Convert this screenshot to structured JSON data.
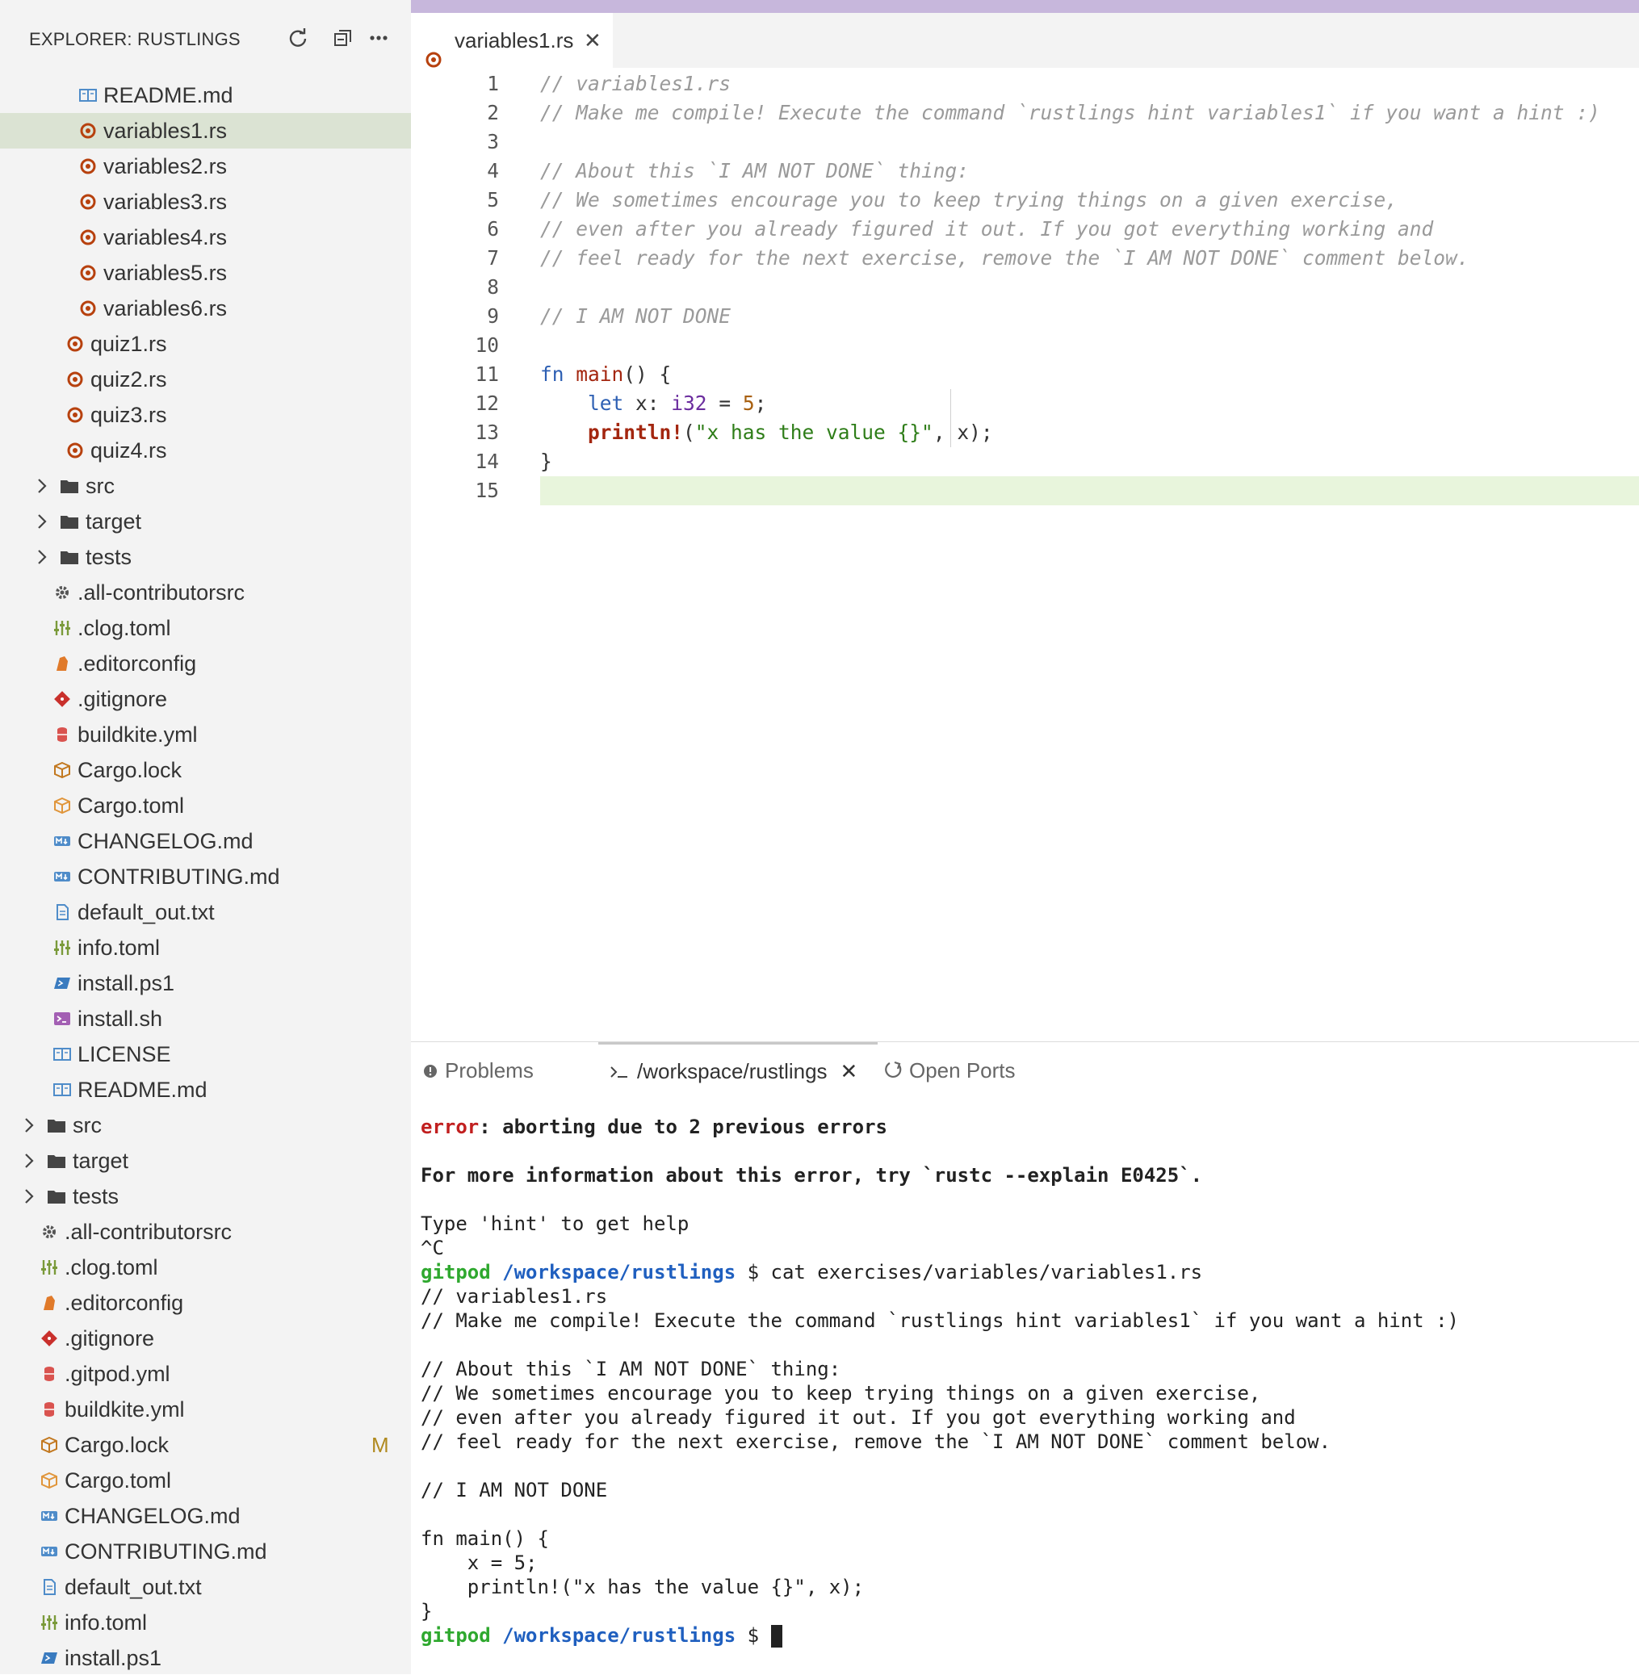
{
  "sidebar": {
    "title": "EXPLORER: RUSTLINGS",
    "tree": [
      {
        "label": "README.md",
        "icon": "readme-icon",
        "level": 3
      },
      {
        "label": "variables1.rs",
        "icon": "rust-file-icon",
        "level": 3,
        "selected": true
      },
      {
        "label": "variables2.rs",
        "icon": "rust-file-icon",
        "level": 3
      },
      {
        "label": "variables3.rs",
        "icon": "rust-file-icon",
        "level": 3
      },
      {
        "label": "variables4.rs",
        "icon": "rust-file-icon",
        "level": 3
      },
      {
        "label": "variables5.rs",
        "icon": "rust-file-icon",
        "level": 3
      },
      {
        "label": "variables6.rs",
        "icon": "rust-file-icon",
        "level": 3
      },
      {
        "label": "quiz1.rs",
        "icon": "rust-file-icon",
        "level": 2
      },
      {
        "label": "quiz2.rs",
        "icon": "rust-file-icon",
        "level": 2
      },
      {
        "label": "quiz3.rs",
        "icon": "rust-file-icon",
        "level": 2
      },
      {
        "label": "quiz4.rs",
        "icon": "rust-file-icon",
        "level": 2
      },
      {
        "label": "src",
        "icon": "folder-icon",
        "level": 1,
        "folder": true
      },
      {
        "label": "target",
        "icon": "folder-icon",
        "level": 1,
        "folder": true
      },
      {
        "label": "tests",
        "icon": "folder-icon",
        "level": 1,
        "folder": true
      },
      {
        "label": ".all-contributorsrc",
        "icon": "gear-icon",
        "level": 1
      },
      {
        "label": ".clog.toml",
        "icon": "toml-icon",
        "level": 1
      },
      {
        "label": ".editorconfig",
        "icon": "editorconfig-icon",
        "level": 1
      },
      {
        "label": ".gitignore",
        "icon": "git-icon",
        "level": 1
      },
      {
        "label": "buildkite.yml",
        "icon": "yaml-icon",
        "level": 1
      },
      {
        "label": "Cargo.lock",
        "icon": "cargo-lock-icon",
        "level": 1
      },
      {
        "label": "Cargo.toml",
        "icon": "cargo-icon",
        "level": 1
      },
      {
        "label": "CHANGELOG.md",
        "icon": "markdown-icon",
        "level": 1
      },
      {
        "label": "CONTRIBUTING.md",
        "icon": "markdown-icon",
        "level": 1
      },
      {
        "label": "default_out.txt",
        "icon": "text-file-icon",
        "level": 1
      },
      {
        "label": "info.toml",
        "icon": "toml-icon",
        "level": 1
      },
      {
        "label": "install.ps1",
        "icon": "powershell-icon",
        "level": 1
      },
      {
        "label": "install.sh",
        "icon": "shell-icon",
        "level": 1
      },
      {
        "label": "LICENSE",
        "icon": "license-icon",
        "level": 1
      },
      {
        "label": "README.md",
        "icon": "readme-icon",
        "level": 1
      },
      {
        "label": "src",
        "icon": "folder-icon",
        "level": 0,
        "folder": true
      },
      {
        "label": "target",
        "icon": "folder-icon",
        "level": 0,
        "folder": true
      },
      {
        "label": "tests",
        "icon": "folder-icon",
        "level": 0,
        "folder": true
      },
      {
        "label": ".all-contributorsrc",
        "icon": "gear-icon",
        "level": 0
      },
      {
        "label": ".clog.toml",
        "icon": "toml-icon",
        "level": 0
      },
      {
        "label": ".editorconfig",
        "icon": "editorconfig-icon",
        "level": 0
      },
      {
        "label": ".gitignore",
        "icon": "git-icon",
        "level": 0
      },
      {
        "label": ".gitpod.yml",
        "icon": "yaml-icon",
        "level": 0
      },
      {
        "label": "buildkite.yml",
        "icon": "yaml-icon",
        "level": 0
      },
      {
        "label": "Cargo.lock",
        "icon": "cargo-lock-icon",
        "level": 0,
        "badge": "M"
      },
      {
        "label": "Cargo.toml",
        "icon": "cargo-icon",
        "level": 0
      },
      {
        "label": "CHANGELOG.md",
        "icon": "markdown-icon",
        "level": 0
      },
      {
        "label": "CONTRIBUTING.md",
        "icon": "markdown-icon",
        "level": 0
      },
      {
        "label": "default_out.txt",
        "icon": "text-file-icon",
        "level": 0
      },
      {
        "label": "info.toml",
        "icon": "toml-icon",
        "level": 0
      },
      {
        "label": "install.ps1",
        "icon": "powershell-icon",
        "level": 0
      }
    ]
  },
  "editor": {
    "tab_label": "variables1.rs",
    "tab_close": "✕",
    "lines": [
      [
        {
          "t": "// variables1.rs",
          "c": "cmt"
        }
      ],
      [
        {
          "t": "// Make me compile! Execute the command `rustlings hint variables1` if you want a hint :)",
          "c": "cmt"
        }
      ],
      [],
      [
        {
          "t": "// About this `I AM NOT DONE` thing:",
          "c": "cmt"
        }
      ],
      [
        {
          "t": "// We sometimes encourage you to keep trying things on a given exercise,",
          "c": "cmt"
        }
      ],
      [
        {
          "t": "// even after you already figured it out. If you got everything working and",
          "c": "cmt"
        }
      ],
      [
        {
          "t": "// feel ready for the next exercise, remove the `I AM NOT DONE` comment below.",
          "c": "cmt"
        }
      ],
      [],
      [
        {
          "t": "// I AM NOT DONE",
          "c": "cmt"
        }
      ],
      [],
      [
        {
          "t": "fn",
          "c": "kw"
        },
        {
          "t": " "
        },
        {
          "t": "main",
          "c": "fn"
        },
        {
          "t": "() {"
        }
      ],
      [
        {
          "t": "    "
        },
        {
          "t": "let",
          "c": "kw"
        },
        {
          "t": " x: "
        },
        {
          "t": "i32",
          "c": "ty"
        },
        {
          "t": " = "
        },
        {
          "t": "5",
          "c": "num"
        },
        {
          "t": ";"
        }
      ],
      [
        {
          "t": "    "
        },
        {
          "t": "println!",
          "c": "mac"
        },
        {
          "t": "("
        },
        {
          "t": "\"x has the value {}\"",
          "c": "str"
        },
        {
          "t": ", x);"
        }
      ],
      [
        {
          "t": "}"
        }
      ],
      []
    ]
  },
  "panel": {
    "tabs": [
      {
        "label": "Problems",
        "icon": "problems-icon"
      },
      {
        "label": "/workspace/rustlings",
        "icon": "terminal-icon",
        "close": "✕",
        "active": true
      },
      {
        "label": "Open Ports",
        "icon": "ports-icon"
      }
    ],
    "terminal": [
      [
        {
          "t": "error",
          "c": "terr"
        },
        {
          "t": ": aborting due to 2 previous errors",
          "c": "tbold"
        }
      ],
      [],
      [
        {
          "t": "For more information about this error, try `rustc --explain E0425`.",
          "c": "tbold"
        }
      ],
      [],
      [
        {
          "t": "Type 'hint' to get help"
        }
      ],
      [
        {
          "t": "^C"
        }
      ],
      [
        {
          "t": "gitpod",
          "c": "tgreen"
        },
        {
          "t": " "
        },
        {
          "t": "/workspace/rustlings",
          "c": "tblue"
        },
        {
          "t": " $ cat exercises/variables/variables1.rs"
        }
      ],
      [
        {
          "t": "// variables1.rs"
        }
      ],
      [
        {
          "t": "// Make me compile! Execute the command `rustlings hint variables1` if you want a hint :)"
        }
      ],
      [],
      [
        {
          "t": "// About this `I AM NOT DONE` thing:"
        }
      ],
      [
        {
          "t": "// We sometimes encourage you to keep trying things on a given exercise,"
        }
      ],
      [
        {
          "t": "// even after you already figured it out. If you got everything working and"
        }
      ],
      [
        {
          "t": "// feel ready for the next exercise, remove the `I AM NOT DONE` comment below."
        }
      ],
      [],
      [
        {
          "t": "// I AM NOT DONE"
        }
      ],
      [],
      [
        {
          "t": "fn main() {"
        }
      ],
      [
        {
          "t": "    x = 5;"
        }
      ],
      [
        {
          "t": "    println!(\"x has the value {}\", x);"
        }
      ],
      [
        {
          "t": "}"
        }
      ],
      [
        {
          "t": "gitpod",
          "c": "tgreen"
        },
        {
          "t": " "
        },
        {
          "t": "/workspace/rustlings",
          "c": "tblue"
        },
        {
          "t": " $ "
        },
        {
          "cursor": true
        }
      ]
    ]
  },
  "colors": {
    "selected_row": "#dbe3d3",
    "current_line": "#e8f5dc",
    "top_accent": "#c7b7dc"
  }
}
